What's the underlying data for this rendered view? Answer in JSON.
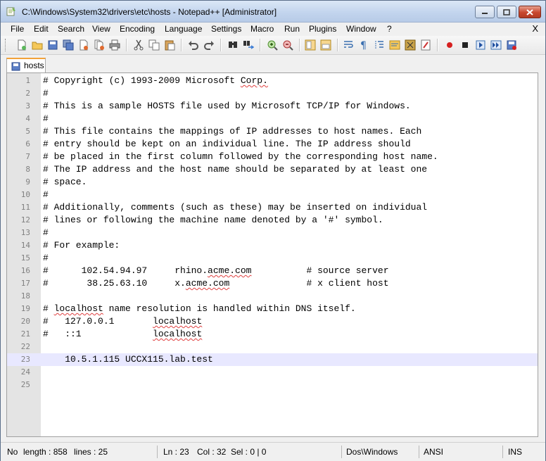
{
  "window": {
    "title": "C:\\Windows\\System32\\drivers\\etc\\hosts - Notepad++ [Administrator]",
    "buttons": {
      "minimize": "minimize",
      "maximize": "maximize",
      "close": "close"
    }
  },
  "menu": {
    "items": [
      "File",
      "Edit",
      "Search",
      "View",
      "Encoding",
      "Language",
      "Settings",
      "Macro",
      "Run",
      "Plugins",
      "Window",
      "?"
    ],
    "close_doc": "X"
  },
  "toolbar": {
    "icons": [
      "new-file-icon",
      "open-file-icon",
      "save-icon",
      "save-all-icon",
      "close-icon",
      "close-all-icon",
      "print-icon",
      "cut-icon",
      "copy-icon",
      "paste-icon",
      "undo-icon",
      "redo-icon",
      "find-icon",
      "replace-icon",
      "zoom-in-icon",
      "zoom-out-icon",
      "sync-vertical-icon",
      "sync-horizontal-icon",
      "word-wrap-icon",
      "show-all-chars-icon",
      "indent-guide-icon",
      "folder-icon",
      "doc-map-icon",
      "function-list-icon",
      "record-macro-icon",
      "stop-record-icon",
      "play-macro-icon",
      "run-macro-multiple-icon",
      "save-macro-icon"
    ]
  },
  "tabs": [
    {
      "label": "hosts",
      "active": true
    }
  ],
  "editor": {
    "lines": [
      "# Copyright (c) 1993-2009 Microsoft Corp.",
      "#",
      "# This is a sample HOSTS file used by Microsoft TCP/IP for Windows.",
      "#",
      "# This file contains the mappings of IP addresses to host names. Each",
      "# entry should be kept on an individual line. The IP address should",
      "# be placed in the first column followed by the corresponding host name.",
      "# The IP address and the host name should be separated by at least one",
      "# space.",
      "#",
      "# Additionally, comments (such as these) may be inserted on individual",
      "# lines or following the machine name denoted by a '#' symbol.",
      "#",
      "# For example:",
      "#",
      "#      102.54.94.97     rhino.acme.com          # source server",
      "#       38.25.63.10     x.acme.com              # x client host",
      "",
      "# localhost name resolution is handled within DNS itself.",
      "#   127.0.0.1       localhost",
      "#   ::1             localhost",
      "",
      "    10.5.1.115 UCCX115.lab.test",
      "",
      ""
    ],
    "current_line": 23
  },
  "status": {
    "mode": "No",
    "length": "length : 858",
    "lines": "lines : 25",
    "ln": "Ln : 23",
    "col": "Col : 32",
    "sel": "Sel : 0 | 0",
    "eol": "Dos\\Windows",
    "encoding": "ANSI",
    "ins": "INS"
  },
  "colors": {
    "current_line": "#e8e8ff",
    "gutter": "#e4e4e4",
    "tab_accent": "#f2a33b",
    "line_number": "#808080"
  }
}
